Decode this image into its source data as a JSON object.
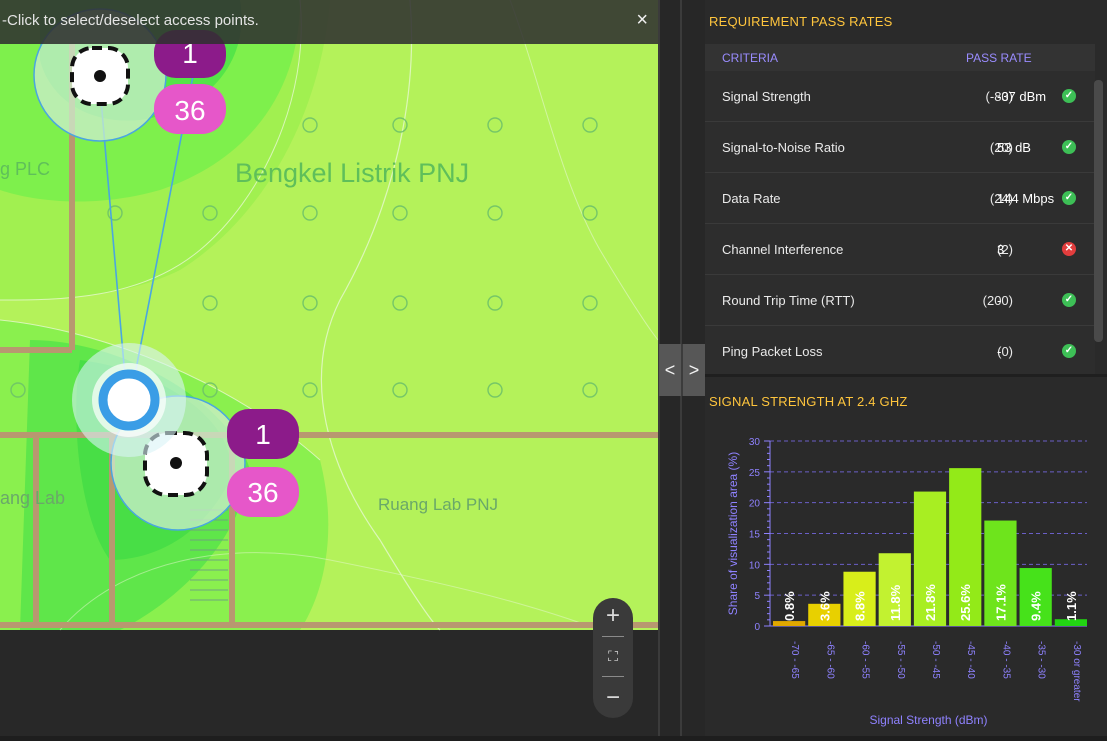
{
  "map": {
    "banner_text": "-Click to select/deselect access points.",
    "close_icon": "×",
    "labels": {
      "bengkel": "Bengkel Listrik PNJ",
      "plc": "g PLC",
      "lab_left": "ang Lab",
      "lab_right": "Ruang Lab PNJ"
    },
    "ap1": {
      "channel": "1",
      "band": "36"
    },
    "ap2": {
      "channel": "1",
      "band": "36"
    },
    "zoom": {
      "in": "+",
      "fit": "⛶",
      "out": "−"
    },
    "colors": {
      "heat_lime": "#b4f25a",
      "heat_green": "#7ef04c",
      "heat_deep": "#55e548",
      "wall": "#b89870",
      "channel_badge": "#8c1b8a",
      "band_badge": "#e657c9",
      "ap_blue": "#3a9de6"
    }
  },
  "nav": {
    "prev": "<",
    "next": ">"
  },
  "requirements": {
    "title": "REQUIREMENT PASS RATES",
    "col_criteria": "CRITERIA",
    "col_pass": "PASS RATE",
    "rows": [
      {
        "name": "Signal Strength",
        "req": "(-80)",
        "value": "-37 dBm",
        "status": "pass"
      },
      {
        "name": "Signal-to-Noise Ratio",
        "req": "(20)",
        "value": "53 dB",
        "status": "pass"
      },
      {
        "name": "Data Rate",
        "req": "(24)",
        "value": "144 Mbps",
        "status": "pass"
      },
      {
        "name": "Channel Interference",
        "req": "(2)",
        "value": "3",
        "status": "fail"
      },
      {
        "name": "Round Trip Time (RTT)",
        "req": "(200)",
        "value": "-",
        "status": "pass"
      },
      {
        "name": "Ping Packet Loss",
        "req": "(0)",
        "value": "-",
        "status": "pass"
      }
    ],
    "pass_color": "#3dbf56",
    "fail_color": "#e23d3d"
  },
  "chart_title": "SIGNAL STRENGTH AT 2.4 GHZ",
  "chart_data": {
    "type": "bar",
    "categories": [
      "-70 - -65",
      "-65 - -60",
      "-60 - -55",
      "-55 - -50",
      "-50 - -45",
      "-45 - -40",
      "-40 - -35",
      "-35 - -30",
      "-30 or greater"
    ],
    "values": [
      0.8,
      3.6,
      8.8,
      11.8,
      21.8,
      25.6,
      17.1,
      9.4,
      1.1
    ],
    "labels": [
      "0.8%",
      "3.6%",
      "8.8%",
      "11.8%",
      "21.8%",
      "25.6%",
      "17.1%",
      "9.4%",
      "1.1%"
    ],
    "colors": [
      "#e0a800",
      "#e8d000",
      "#d8ee1a",
      "#c2f230",
      "#a8ee22",
      "#93ea18",
      "#6ee41c",
      "#46e21a",
      "#22d412"
    ],
    "xlabel": "Signal Strength (dBm)",
    "ylabel": "Share of visualization area (%)",
    "ylim": [
      0,
      30
    ],
    "yticks": [
      0,
      5,
      10,
      15,
      20,
      25,
      30
    ],
    "grid": true
  }
}
